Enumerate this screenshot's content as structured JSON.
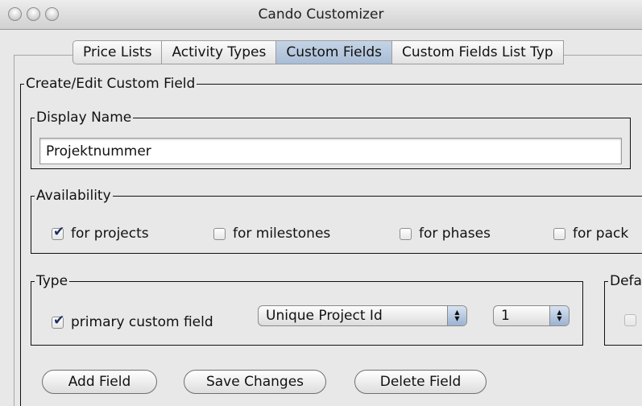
{
  "window": {
    "title": "Cando Customizer"
  },
  "tabs": [
    {
      "label": "Price Lists"
    },
    {
      "label": "Activity Types"
    },
    {
      "label": "Custom Fields"
    },
    {
      "label": "Custom Fields List Typ"
    }
  ],
  "form": {
    "group_title": "Create/Edit Custom Field",
    "display_name": {
      "legend": "Display Name",
      "value": "Projektnummer"
    },
    "availability": {
      "legend": "Availability",
      "options": [
        {
          "label": "for projects",
          "checked": true
        },
        {
          "label": "for milestones",
          "checked": false
        },
        {
          "label": "for phases",
          "checked": false
        },
        {
          "label": "for pack",
          "checked": false
        }
      ]
    },
    "type": {
      "legend": "Type",
      "primary_label": "primary custom field",
      "primary_checked": true,
      "type_select": "Unique Project Id",
      "number_select": "1"
    },
    "default": {
      "legend": "Defa"
    }
  },
  "buttons": {
    "add": "Add Field",
    "save": "Save Changes",
    "delete": "Delete Field"
  }
}
